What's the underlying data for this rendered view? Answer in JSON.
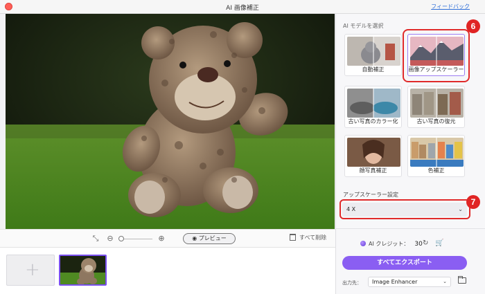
{
  "window": {
    "title": "AI 画像補正",
    "feedback_link": "フィードバック"
  },
  "toolbar": {
    "preview_label": "プレビュー",
    "delete_all_label": "すべて削除",
    "icons": [
      "fit-screen-icon",
      "zoom-out-icon",
      "zoom-in-icon",
      "eye-icon",
      "trash-icon"
    ]
  },
  "right_panel": {
    "model_section_label": "AI モデルを選択",
    "models": [
      {
        "label": "自動補正",
        "selected": false
      },
      {
        "label": "画像アップスケーラー",
        "selected": true
      },
      {
        "label": "古い写真のカラー化",
        "selected": false
      },
      {
        "label": "古い写真の復元",
        "selected": false
      },
      {
        "label": "顔写真補正",
        "selected": false
      },
      {
        "label": "色補正",
        "selected": false
      }
    ],
    "upscaler_settings_label": "アップスケーラー設定",
    "upscale_value": "4 X",
    "credits_label": "AI クレジット：",
    "credits_value": "30",
    "export_all_label": "すべてエクスポート",
    "output_label": "出力先：",
    "output_value": "Image Enhancer"
  },
  "annotations": {
    "badge_model": "6",
    "badge_setting": "7"
  },
  "colors": {
    "accent": "#8a5ef2",
    "annotation_red": "#e02424"
  }
}
